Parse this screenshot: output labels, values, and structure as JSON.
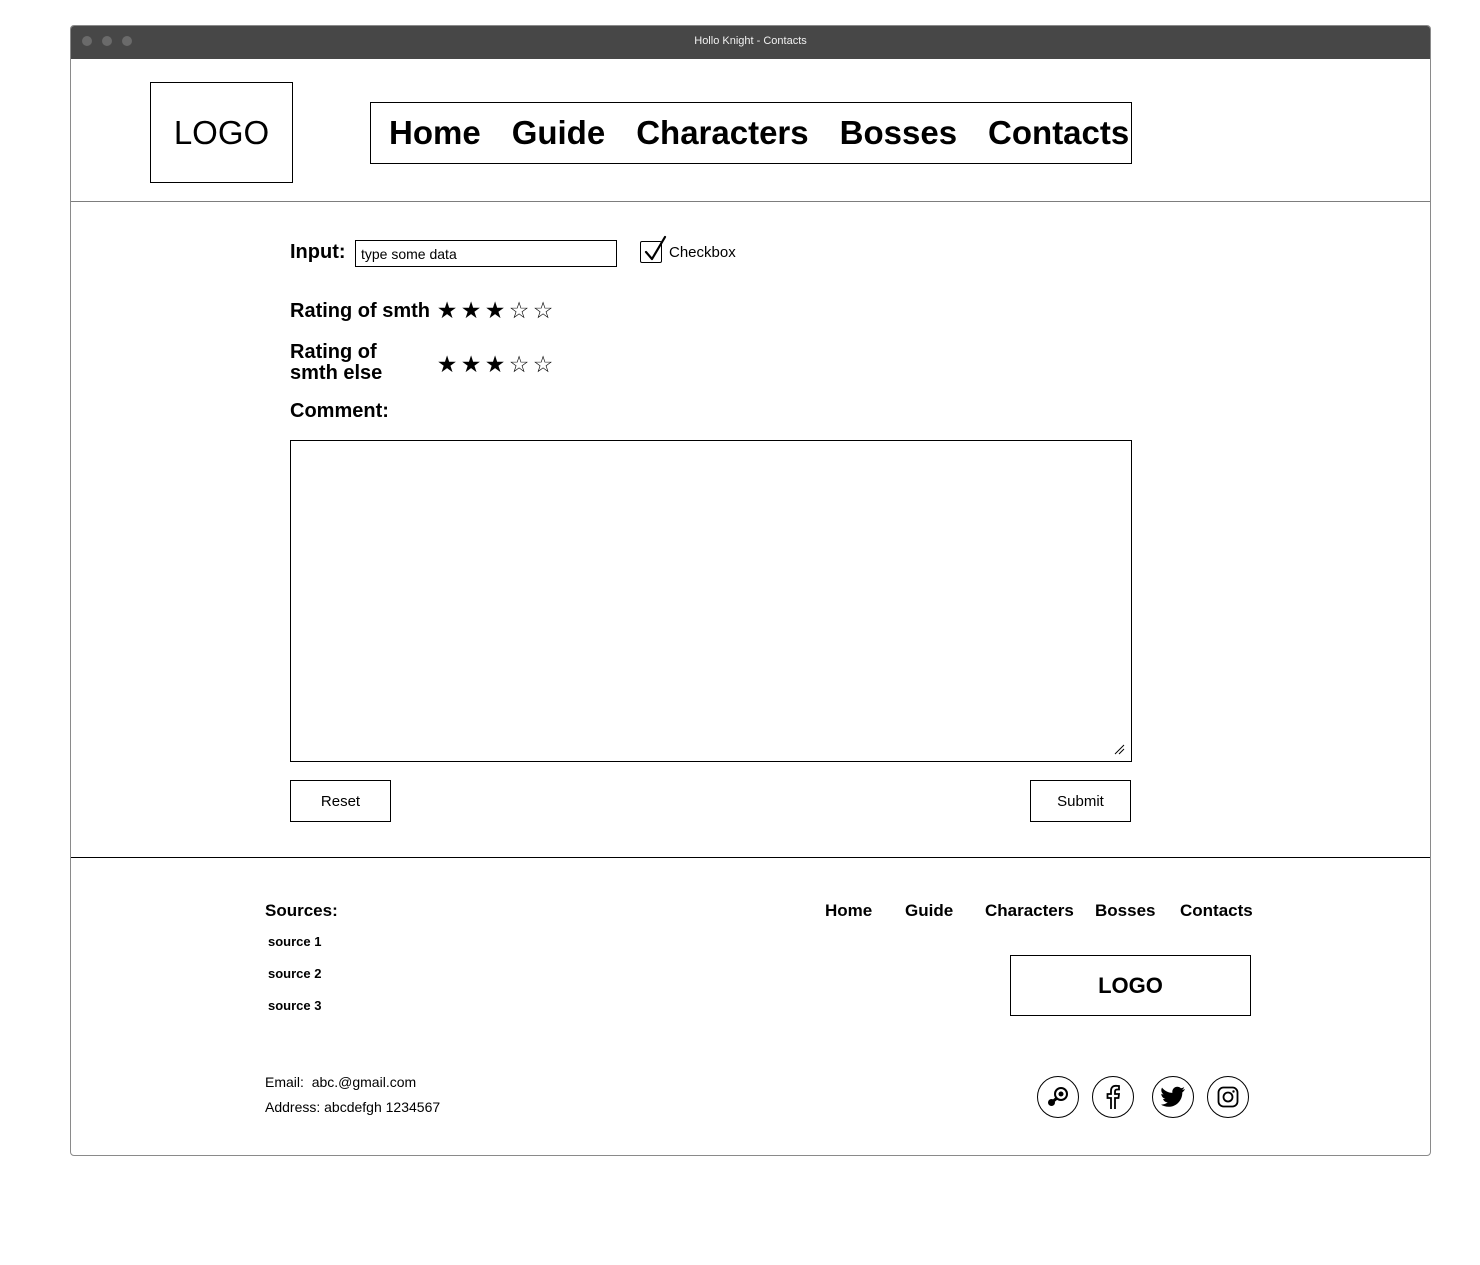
{
  "window": {
    "title": "Hollo Knight - Contacts"
  },
  "header": {
    "logo": "LOGO",
    "nav": [
      "Home",
      "Guide",
      "Characters",
      "Bosses",
      "Contacts"
    ]
  },
  "form": {
    "input_label": "Input:",
    "input_value": "type some data",
    "checkbox_label": "Checkbox",
    "checkbox_checked": true,
    "rating1_label": "Rating of smth",
    "rating1_value": 3,
    "rating2_label_line1": "Rating of",
    "rating2_label_line2": "smth else",
    "rating2_value": 3,
    "rating_max": 5,
    "comment_label": "Comment:",
    "comment_value": "",
    "reset_label": "Reset",
    "submit_label": "Submit"
  },
  "footer": {
    "sources_title": "Sources:",
    "sources": [
      "source 1",
      "source 2",
      "source 3"
    ],
    "nav": [
      "Home",
      "Guide",
      "Characters",
      "Bosses",
      "Contacts"
    ],
    "logo": "LOGO",
    "email_label": "Email:",
    "email_value": "abc.@gmail.com",
    "address_label": "Address:",
    "address_value": "abcdefgh 1234567",
    "social_icons": [
      "steam-icon",
      "facebook-icon",
      "twitter-icon",
      "instagram-icon"
    ]
  }
}
